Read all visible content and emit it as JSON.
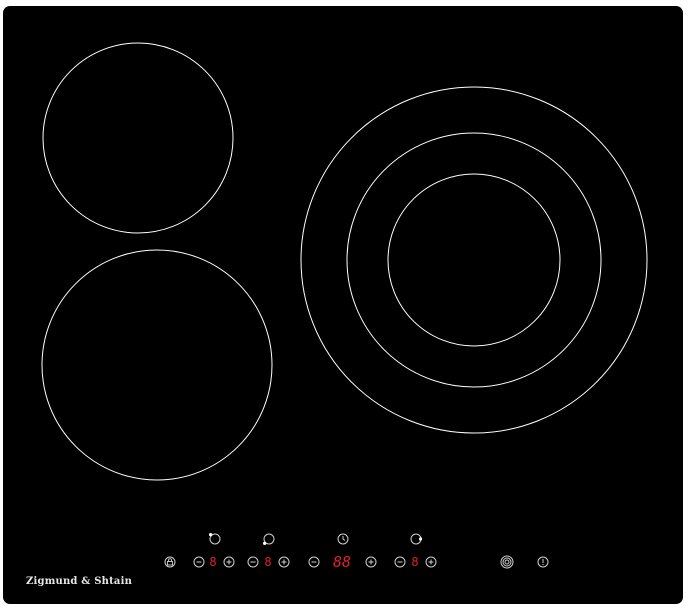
{
  "brand": {
    "name": "Zigmund & Shtain"
  },
  "controls": {
    "lock_icon": "lock-icon",
    "zone_displays": [
      "8",
      "8",
      "8"
    ],
    "timer_display": "88",
    "minus_icon": "minus-icon",
    "plus_icon": "plus-icon",
    "booster_icon": "booster-icon",
    "power_icon": "power-icon"
  },
  "colors": {
    "surface": "#000000",
    "outline": "#ffffff",
    "display": "#e0202a",
    "icon": "#cfcfcf"
  }
}
